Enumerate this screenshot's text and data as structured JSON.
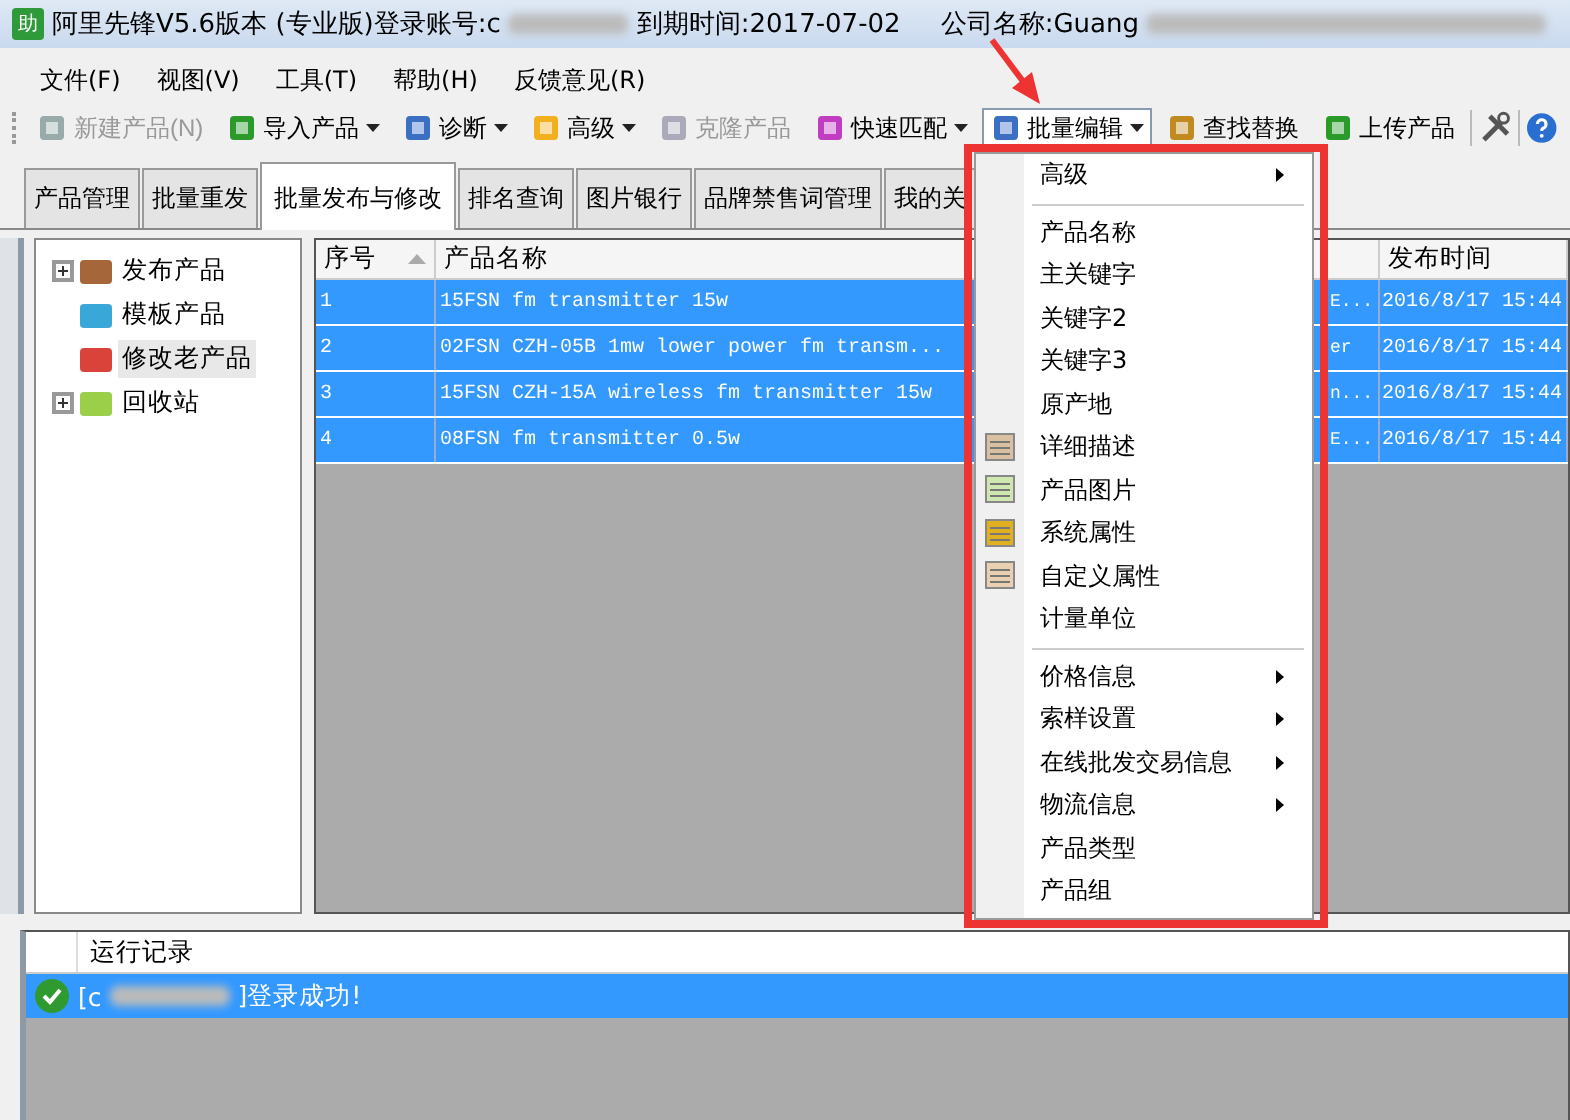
{
  "window": {
    "app_icon_text": "助",
    "title_parts": [
      "阿里先锋V5.6版本 (专业版)登录账号:c",
      "到期时间:2017-07-02",
      "公司名称:Guang"
    ]
  },
  "menubar": [
    "文件(F)",
    "视图(V)",
    "工具(T)",
    "帮助(H)",
    "反馈意见(R)"
  ],
  "toolbar": [
    {
      "label": "新建产品(N)",
      "disabled": true,
      "dropdown": false,
      "selected": false
    },
    {
      "label": "导入产品",
      "disabled": false,
      "dropdown": true,
      "selected": false
    },
    {
      "label": "诊断",
      "disabled": false,
      "dropdown": true,
      "selected": false
    },
    {
      "label": "高级",
      "disabled": false,
      "dropdown": true,
      "selected": false
    },
    {
      "label": "克隆产品",
      "disabled": true,
      "dropdown": false,
      "selected": false
    },
    {
      "label": "快速匹配",
      "disabled": false,
      "dropdown": true,
      "selected": false
    },
    {
      "label": "批量编辑",
      "disabled": false,
      "dropdown": true,
      "selected": true
    },
    {
      "label": "查找替换",
      "disabled": false,
      "dropdown": false,
      "selected": false
    },
    {
      "label": "上传产品",
      "disabled": false,
      "dropdown": false,
      "selected": false
    }
  ],
  "tabs": [
    {
      "label": "产品管理",
      "selected": false
    },
    {
      "label": "批量重发",
      "selected": false
    },
    {
      "label": "批量发布与修改",
      "selected": true
    },
    {
      "label": "排名查询",
      "selected": false
    },
    {
      "label": "图片银行",
      "selected": false
    },
    {
      "label": "品牌禁售词管理",
      "selected": false
    },
    {
      "label": "我的关",
      "selected": false
    }
  ],
  "tree": [
    {
      "label": "发布产品",
      "expandable": true,
      "selected": false
    },
    {
      "label": "模板产品",
      "expandable": false,
      "selected": false
    },
    {
      "label": "修改老产品",
      "expandable": false,
      "selected": true
    },
    {
      "label": "回收站",
      "expandable": true,
      "selected": false
    }
  ],
  "table": {
    "columns": [
      "序号",
      "产品名称",
      "",
      "发布时间"
    ],
    "rows": [
      {
        "cells": [
          "1",
          "15FSN fm transmitter 15w",
          "E...",
          "2016/8/17 15:44"
        ],
        "selected": true
      },
      {
        "cells": [
          "2",
          "02FSN CZH-05B 1mw lower power fm transm...",
          "er",
          "2016/8/17 15:44"
        ],
        "selected": true
      },
      {
        "cells": [
          "3",
          "15FSN CZH-15A wireless fm transmitter 15w",
          "n...",
          "2016/8/17 15:44"
        ],
        "selected": true
      },
      {
        "cells": [
          "4",
          "08FSN fm transmitter 0.5w",
          "E...",
          "2016/8/17 15:44"
        ],
        "selected": true
      }
    ]
  },
  "context_menu": {
    "items": [
      {
        "kind": "item",
        "label": "高级",
        "submenu": true,
        "has_icon": false
      },
      {
        "kind": "separator"
      },
      {
        "kind": "item",
        "label": "产品名称",
        "submenu": false,
        "has_icon": false
      },
      {
        "kind": "item",
        "label": "主关键字",
        "submenu": false,
        "has_icon": false
      },
      {
        "kind": "item",
        "label": "关键字2",
        "submenu": false,
        "has_icon": false
      },
      {
        "kind": "item",
        "label": "关键字3",
        "submenu": false,
        "has_icon": false
      },
      {
        "kind": "item",
        "label": "原产地",
        "submenu": false,
        "has_icon": false
      },
      {
        "kind": "item",
        "label": "详细描述",
        "submenu": false,
        "has_icon": true
      },
      {
        "kind": "item",
        "label": "产品图片",
        "submenu": false,
        "has_icon": true
      },
      {
        "kind": "item",
        "label": "系统属性",
        "submenu": false,
        "has_icon": true
      },
      {
        "kind": "item",
        "label": "自定义属性",
        "submenu": false,
        "has_icon": true
      },
      {
        "kind": "item",
        "label": "计量单位",
        "submenu": false,
        "has_icon": false
      },
      {
        "kind": "separator"
      },
      {
        "kind": "item",
        "label": "价格信息",
        "submenu": true,
        "has_icon": false
      },
      {
        "kind": "item",
        "label": "索样设置",
        "submenu": true,
        "has_icon": false
      },
      {
        "kind": "item",
        "label": "在线批发交易信息",
        "submenu": true,
        "has_icon": false
      },
      {
        "kind": "item",
        "label": "物流信息",
        "submenu": true,
        "has_icon": false
      },
      {
        "kind": "item",
        "label": "产品类型",
        "submenu": false,
        "has_icon": false
      },
      {
        "kind": "item",
        "label": "产品组",
        "submenu": false,
        "has_icon": false
      }
    ]
  },
  "log": {
    "header": "运行记录",
    "rows": [
      {
        "prefix": "[c",
        "message": "]登录成功!",
        "selected": true
      }
    ]
  }
}
